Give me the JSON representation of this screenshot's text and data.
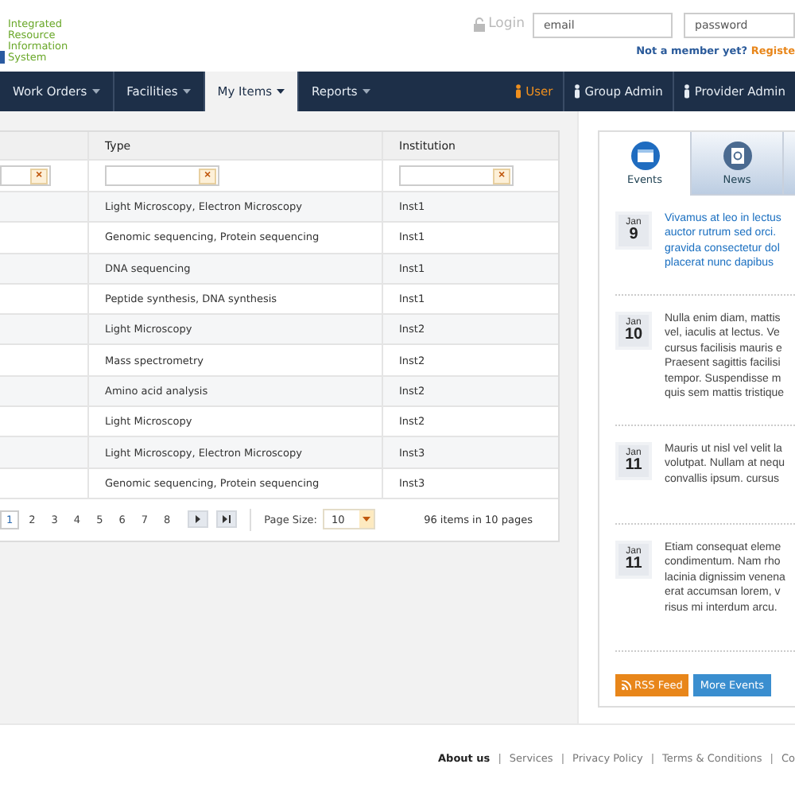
{
  "logo": {
    "text": "Integrated\nResource\nInformation\nSystem"
  },
  "login": {
    "label": "Login",
    "email_placeholder": "email",
    "password_placeholder": "password",
    "signup_prompt": "Not a member yet?",
    "signup_link": "Registe"
  },
  "nav": {
    "menus": [
      {
        "label": "Work Orders",
        "selected": false
      },
      {
        "label": "Facilities",
        "selected": false
      },
      {
        "label": "My Items",
        "selected": true
      },
      {
        "label": "Reports",
        "selected": false
      }
    ],
    "roles": [
      {
        "label": "User",
        "selected": true
      },
      {
        "label": "Group Admin",
        "selected": false
      },
      {
        "label": "Provider Admin",
        "selected": false
      }
    ]
  },
  "table": {
    "columns": [
      "",
      "Type",
      "Institution"
    ],
    "filters": [
      {
        "clear": "×"
      },
      {
        "clear": "×"
      },
      {
        "clear": "×"
      }
    ],
    "rows": [
      [
        "",
        "Light Microscopy, Electron Microscopy",
        "Inst1"
      ],
      [
        "",
        "Genomic sequencing, Protein sequencing",
        "Inst1"
      ],
      [
        "",
        "DNA sequencing",
        "Inst1"
      ],
      [
        "",
        "Peptide synthesis, DNA synthesis",
        "Inst1"
      ],
      [
        "",
        "Light Microscopy",
        "Inst2"
      ],
      [
        "",
        "Mass spectrometry",
        "Inst2"
      ],
      [
        "",
        "Amino acid analysis",
        "Inst2"
      ],
      [
        "",
        "Light Microscopy",
        "Inst2"
      ],
      [
        "",
        "Light Microscopy, Electron Microscopy",
        "Inst3"
      ],
      [
        "",
        "Genomic sequencing, Protein sequencing",
        "Inst3"
      ]
    ],
    "pager": {
      "pages": [
        {
          "label": "1",
          "selected": true
        },
        {
          "label": "2",
          "selected": false
        },
        {
          "label": "3",
          "selected": false
        },
        {
          "label": "4",
          "selected": false
        },
        {
          "label": "5",
          "selected": false
        },
        {
          "label": "6",
          "selected": false
        },
        {
          "label": "7",
          "selected": false
        },
        {
          "label": "8",
          "selected": false
        }
      ],
      "page_size_label": "Page Size:",
      "page_size": "10",
      "summary": "96 items in 10 pages"
    }
  },
  "sidebar": {
    "tabs": [
      {
        "label": "Events",
        "kind": "calendar",
        "selected": true
      },
      {
        "label": "News",
        "kind": "mail",
        "selected": false
      }
    ],
    "events": [
      {
        "month": "Jan",
        "day": "9",
        "highlighted": true,
        "text": "Vivamus at leo in lectus\nauctor rutrum sed orci.\ngravida consectetur dol\nplacerat nunc dapibus"
      },
      {
        "month": "Jan",
        "day": "10",
        "highlighted": false,
        "text": "Nulla enim diam, mattis\nvel, iaculis at lectus. Ve\ncursus facilisis mauris e\nPraesent sagittis facilisi\ntempor. Suspendisse m\nquis sem mattis tristique"
      },
      {
        "month": "Jan",
        "day": "11",
        "highlighted": false,
        "text": "Mauris ut nisl vel velit la\nvolutpat. Nullam at nequ\nconvallis ipsum. cursus"
      },
      {
        "month": "Jan",
        "day": "11",
        "highlighted": false,
        "text": "Etiam consequat eleme\ncondimentum. Nam rho\nlacinia dignissim venena\nerat accumsan lorem, v\nrisus mi interdum arcu."
      }
    ],
    "buttons": [
      {
        "label": "RSS Feed",
        "kind": "rss"
      },
      {
        "label": "More Events",
        "kind": "more"
      }
    ]
  },
  "footer": {
    "links": [
      {
        "label": "About us",
        "selected": true
      },
      {
        "separator": "|",
        "label": "Services",
        "selected": false
      },
      {
        "separator": "|",
        "label": "Privacy Policy",
        "selected": false
      },
      {
        "separator": "|",
        "label": "Terms & Conditions",
        "selected": false
      },
      {
        "separator": "|",
        "label": "Co",
        "selected": false
      }
    ]
  }
}
